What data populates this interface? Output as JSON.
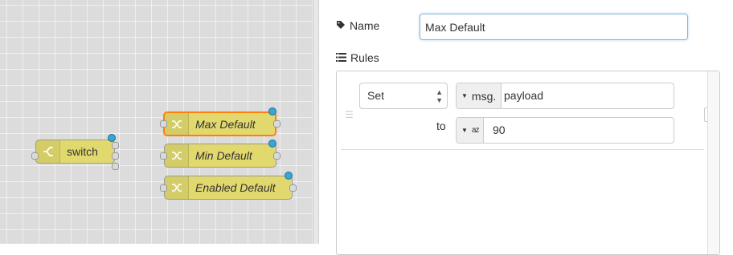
{
  "canvas": {
    "nodes": [
      {
        "label": "switch",
        "icon": "switch-icon",
        "italic": false
      },
      {
        "label": "Max Default",
        "icon": "change-icon",
        "italic": true,
        "selected": true
      },
      {
        "label": "Min Default",
        "icon": "change-icon",
        "italic": true
      },
      {
        "label": "Enabled Default",
        "icon": "change-icon",
        "italic": true
      }
    ],
    "colors": {
      "node_fill": "#e2d96e",
      "selected_border": "#ff7f0e",
      "changed_dot": "#3aa4d6"
    }
  },
  "editor": {
    "name_label": "Name",
    "name_icon": "tag-icon",
    "name_value": "Max Default",
    "rules_label": "Rules",
    "rules_icon": "list-icon",
    "rules": [
      {
        "action": "Set",
        "property_type": "msg.",
        "property_value": "payload",
        "to_label": "to",
        "value_type_icon": "az-icon",
        "value_type_glyph": "az",
        "value": "90"
      }
    ]
  }
}
